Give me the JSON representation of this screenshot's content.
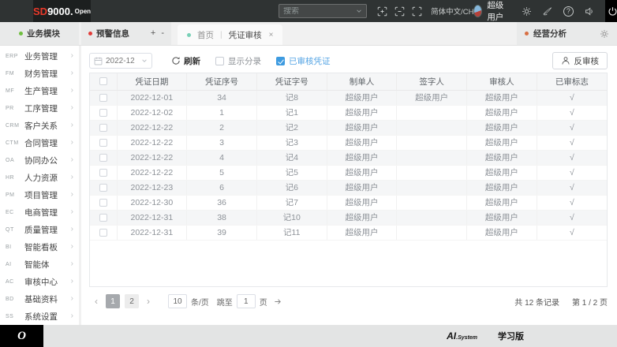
{
  "topbar": {
    "logo_sd": "SD",
    "logo_num": "9000.",
    "logo_open": "Open",
    "search_placeholder": "搜索",
    "language": "简体中文/CH",
    "username": "超级用户"
  },
  "tabbar": {
    "module_header": "业务模块",
    "warning_title": "预警信息",
    "warning_plus": "+",
    "warning_minus": "-",
    "tab_home": "首页",
    "tab_separator": "|",
    "tab_active": "凭证审核",
    "tab_close": "×",
    "analysis_title": "经营分析"
  },
  "sidebar": {
    "items": [
      {
        "code": "ERP",
        "label": "业务管理",
        "chev": "›"
      },
      {
        "code": "FM",
        "label": "财务管理",
        "chev": "›"
      },
      {
        "code": "MF",
        "label": "生产管理",
        "chev": "›"
      },
      {
        "code": "PR",
        "label": "工序管理",
        "chev": "›"
      },
      {
        "code": "CRM",
        "label": "客户关系",
        "chev": "›"
      },
      {
        "code": "CTM",
        "label": "合同管理",
        "chev": "›"
      },
      {
        "code": "OA",
        "label": "协同办公",
        "chev": "›"
      },
      {
        "code": "HR",
        "label": "人力资源",
        "chev": "›"
      },
      {
        "code": "PM",
        "label": "项目管理",
        "chev": "›"
      },
      {
        "code": "EC",
        "label": "电商管理",
        "chev": "›"
      },
      {
        "code": "QT",
        "label": "质量管理",
        "chev": "›"
      },
      {
        "code": "BI",
        "label": "智能看板",
        "chev": "›"
      },
      {
        "code": "AI",
        "label": "智能体",
        "chev": "›"
      },
      {
        "code": "AC",
        "label": "审核中心",
        "chev": "›"
      },
      {
        "code": "BD",
        "label": "基础资料",
        "chev": "›"
      },
      {
        "code": "SS",
        "label": "系统设置",
        "chev": "›"
      }
    ]
  },
  "toolbar": {
    "period": "2022-12",
    "refresh": "刷新",
    "show_entries": "显示分录",
    "audited_vouchers": "已审核凭证",
    "reverse_audit": "反审核"
  },
  "table": {
    "columns": [
      "凭证日期",
      "凭证序号",
      "凭证字号",
      "制单人",
      "签字人",
      "审核人",
      "已审标志"
    ],
    "rows": [
      {
        "date": "2022-12-01",
        "seq": "34",
        "word": "记8",
        "maker": "超级用户",
        "signer": "超级用户",
        "auditor": "超级用户",
        "flag": "√"
      },
      {
        "date": "2022-12-02",
        "seq": "1",
        "word": "记1",
        "maker": "超级用户",
        "signer": "",
        "auditor": "超级用户",
        "flag": "√"
      },
      {
        "date": "2022-12-22",
        "seq": "2",
        "word": "记2",
        "maker": "超级用户",
        "signer": "",
        "auditor": "超级用户",
        "flag": "√"
      },
      {
        "date": "2022-12-22",
        "seq": "3",
        "word": "记3",
        "maker": "超级用户",
        "signer": "",
        "auditor": "超级用户",
        "flag": "√"
      },
      {
        "date": "2022-12-22",
        "seq": "4",
        "word": "记4",
        "maker": "超级用户",
        "signer": "",
        "auditor": "超级用户",
        "flag": "√"
      },
      {
        "date": "2022-12-22",
        "seq": "5",
        "word": "记5",
        "maker": "超级用户",
        "signer": "",
        "auditor": "超级用户",
        "flag": "√"
      },
      {
        "date": "2022-12-23",
        "seq": "6",
        "word": "记6",
        "maker": "超级用户",
        "signer": "",
        "auditor": "超级用户",
        "flag": "√"
      },
      {
        "date": "2022-12-30",
        "seq": "36",
        "word": "记7",
        "maker": "超级用户",
        "signer": "",
        "auditor": "超级用户",
        "flag": "√"
      },
      {
        "date": "2022-12-31",
        "seq": "38",
        "word": "记10",
        "maker": "超级用户",
        "signer": "",
        "auditor": "超级用户",
        "flag": "√"
      },
      {
        "date": "2022-12-31",
        "seq": "39",
        "word": "记11",
        "maker": "超级用户",
        "signer": "",
        "auditor": "超级用户",
        "flag": "√"
      }
    ]
  },
  "pagination": {
    "prev": "‹",
    "page1": "1",
    "page2": "2",
    "next": "›",
    "page_size": "10",
    "per_page": "条/页",
    "jump_to": "跳至",
    "jump_value": "1",
    "page_unit": "页",
    "total": "共 12 条记录",
    "current": "第 1 / 2 页"
  },
  "bottombar": {
    "logo": "O",
    "ai": "AI",
    "system": ".System",
    "edition": "学习版"
  },
  "colors": {
    "accent_red": "#e8392a",
    "module_green": "#6fbf3f",
    "tab_teal": "#79d0b7",
    "analysis_orange": "#d86f43",
    "link_blue": "#54a4e4"
  }
}
